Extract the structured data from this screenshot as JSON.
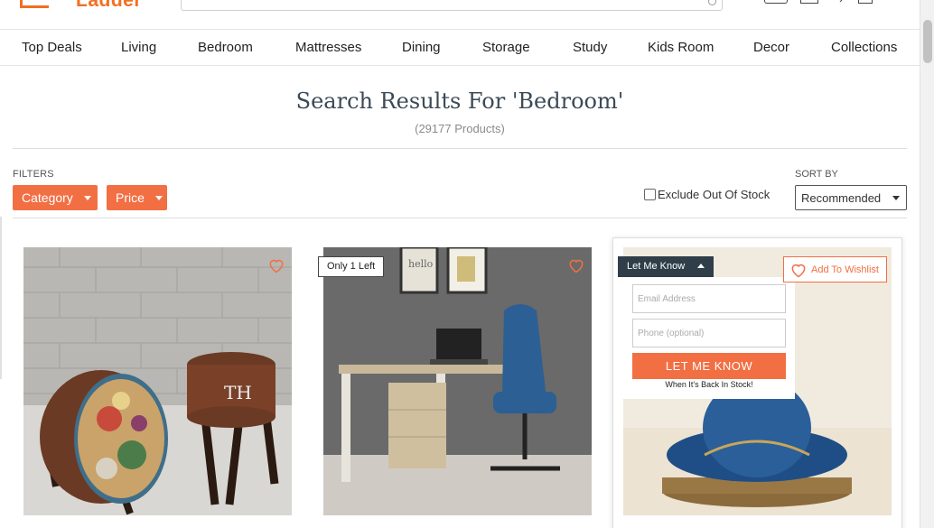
{
  "brand": {
    "logo_text": "Ladder"
  },
  "nav": {
    "items": [
      "Top Deals",
      "Living",
      "Bedroom",
      "Mattresses",
      "Dining",
      "Storage",
      "Study",
      "Kids Room",
      "Decor",
      "Collections"
    ]
  },
  "results": {
    "title": "Search Results For 'Bedroom'",
    "count": "(29177 Products)"
  },
  "filters": {
    "label": "FILTERS",
    "category": "Category",
    "price": "Price",
    "exclude_out_of_stock": "Exclude Out Of Stock"
  },
  "sort": {
    "label": "SORT BY",
    "selected": "Recommended"
  },
  "products": [
    {
      "badge": ""
    },
    {
      "badge": "Only 1 Left"
    },
    {
      "badge": ""
    }
  ],
  "let_me_know": {
    "tab_label": "Let Me Know",
    "email_placeholder": "Email Address",
    "phone_placeholder": "Phone (optional)",
    "button_label": "LET ME KNOW",
    "note": "When It's Back In Stock!"
  },
  "wishlist": {
    "add_label": "Add To Wishlist"
  },
  "colors": {
    "accent": "#f26f44",
    "dark": "#2f3e49"
  }
}
